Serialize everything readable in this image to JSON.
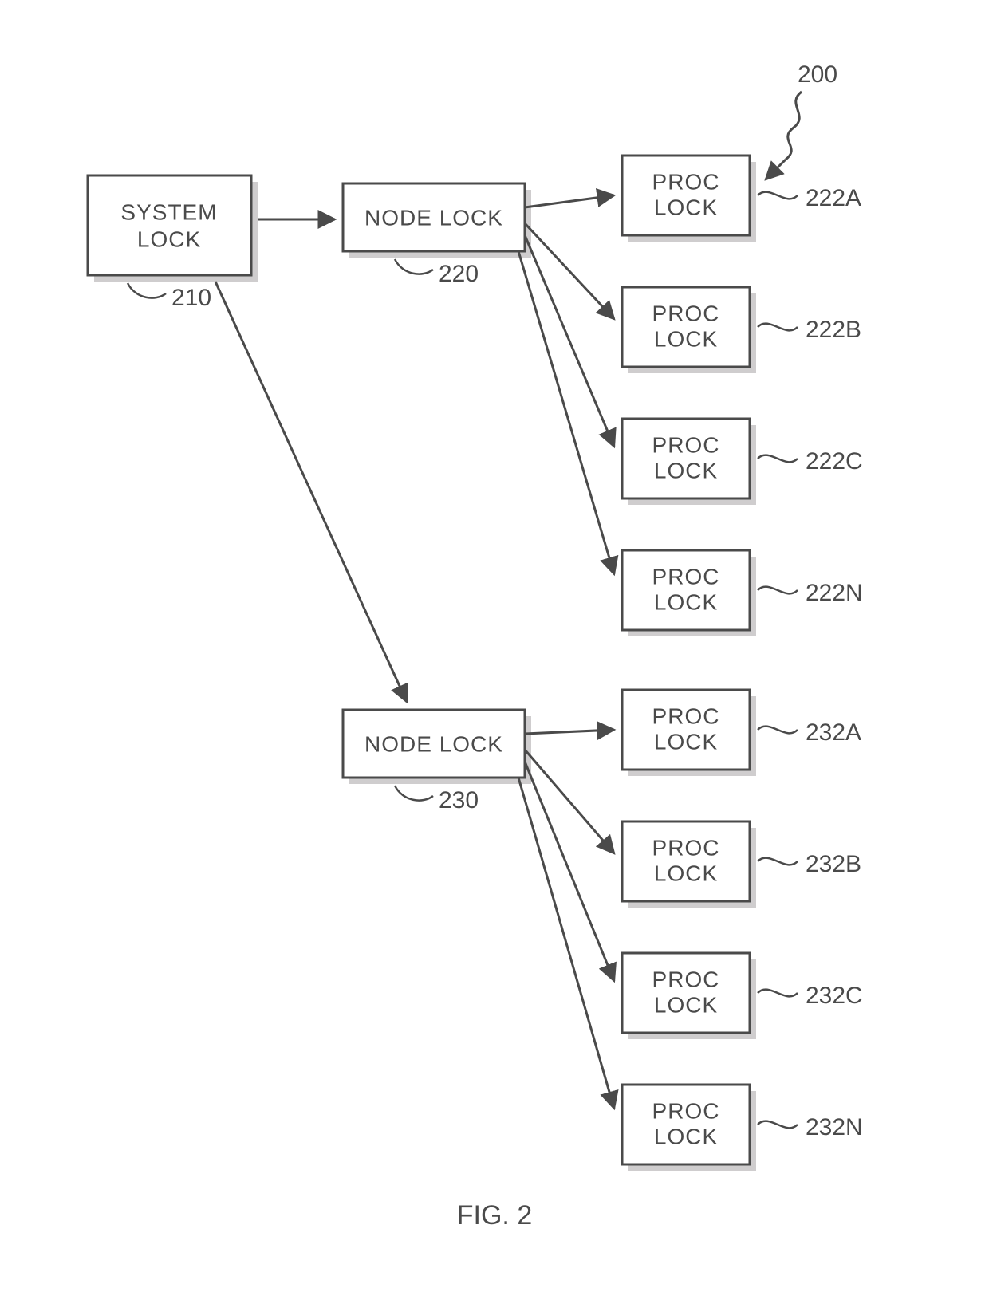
{
  "figure": {
    "caption": "FIG. 2",
    "overall_ref": "200"
  },
  "system_lock": {
    "label_l1": "SYSTEM",
    "label_l2": "LOCK",
    "ref": "210"
  },
  "node_lock_top": {
    "label": "NODE LOCK",
    "ref": "220"
  },
  "node_lock_bottom": {
    "label": "NODE LOCK",
    "ref": "230"
  },
  "proc_locks_top": [
    {
      "label_l1": "PROC",
      "label_l2": "LOCK",
      "ref": "222A"
    },
    {
      "label_l1": "PROC",
      "label_l2": "LOCK",
      "ref": "222B"
    },
    {
      "label_l1": "PROC",
      "label_l2": "LOCK",
      "ref": "222C"
    },
    {
      "label_l1": "PROC",
      "label_l2": "LOCK",
      "ref": "222N"
    }
  ],
  "proc_locks_bottom": [
    {
      "label_l1": "PROC",
      "label_l2": "LOCK",
      "ref": "232A"
    },
    {
      "label_l1": "PROC",
      "label_l2": "LOCK",
      "ref": "232B"
    },
    {
      "label_l1": "PROC",
      "label_l2": "LOCK",
      "ref": "232C"
    },
    {
      "label_l1": "PROC",
      "label_l2": "LOCK",
      "ref": "232N"
    }
  ]
}
